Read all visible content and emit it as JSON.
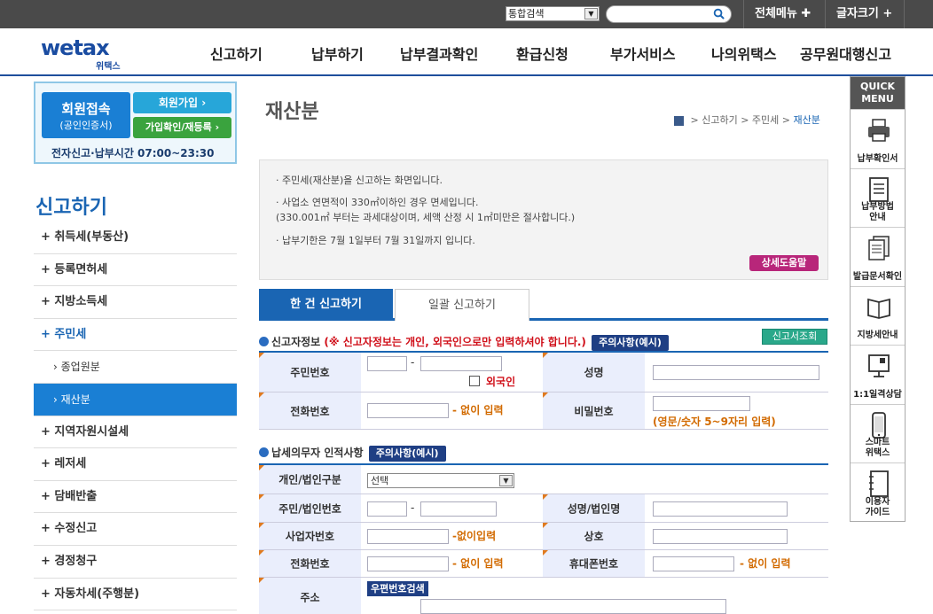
{
  "topbar": {
    "search_select": "통합검색",
    "menu_all": "전체메뉴",
    "font_size": "글자크기"
  },
  "logo": {
    "en": "wetax",
    "kr": "위택스"
  },
  "gnb": [
    "신고하기",
    "납부하기",
    "납부결과확인",
    "환급신청",
    "부가서비스",
    "나의위택스",
    "공무원대행신고"
  ],
  "login_box": {
    "member_login_1": "회원접속",
    "member_login_2": "(공인인증서)",
    "join": "회원가입",
    "rejoin": "가입확인/재등록",
    "hours": "전자신고·납부시간 07:00~23:30"
  },
  "lnb": {
    "title": "신고하기",
    "items": [
      {
        "label": "+ 취득세(부동산)",
        "kind": "item"
      },
      {
        "label": "+ 등록면허세",
        "kind": "item"
      },
      {
        "label": "+ 지방소득세",
        "kind": "item"
      },
      {
        "label": "+ 주민세",
        "kind": "active-parent"
      },
      {
        "label": "› 종업원분",
        "kind": "sub"
      },
      {
        "label": "› 재산분",
        "kind": "selected"
      },
      {
        "label": "+ 지역자원시설세",
        "kind": "item"
      },
      {
        "label": "+ 레저세",
        "kind": "item"
      },
      {
        "label": "+ 담배반출",
        "kind": "item"
      },
      {
        "label": "+ 수정신고",
        "kind": "item"
      },
      {
        "label": "+ 경정청구",
        "kind": "item"
      },
      {
        "label": "+ 자동차세(주행분)",
        "kind": "item"
      }
    ]
  },
  "quick": {
    "head_1": "QUICK",
    "head_2": "MENU",
    "items": [
      {
        "label_1": "납부확인서",
        "label_2": "",
        "icon": "printer-icon"
      },
      {
        "label_1": "납부방법",
        "label_2": "안내",
        "icon": "document-list-icon"
      },
      {
        "label_1": "발급문서확인",
        "label_2": "",
        "icon": "stacked-documents-icon"
      },
      {
        "label_1": "지방세안내",
        "label_2": "",
        "icon": "open-book-icon"
      },
      {
        "label_1": "1:1일격상담",
        "label_2": "",
        "icon": "chat-monitor-icon"
      },
      {
        "label_1": "스마트",
        "label_2": "위택스",
        "icon": "smartphone-icon"
      },
      {
        "label_1": "이용자",
        "label_2": "가이드",
        "icon": "notebook-icon"
      }
    ]
  },
  "page": {
    "title": "재산분",
    "breadcrumb": [
      "신고하기",
      "주민세",
      "재산분"
    ]
  },
  "info": {
    "line1": "· 주민세(재산분)을 신고하는 화면입니다.",
    "line2": "· 사업소 연면적이 330㎡이하인 경우 면세입니다.",
    "line3": "  (330.001㎡ 부터는 과세대상이며, 세액 산정 시 1㎡미만은 절사합니다.)",
    "line4": "· 납부기한은 7월 1일부터 7월 31일까지 입니다.",
    "help_button": "상세도움말"
  },
  "tabs": {
    "single": "한 건 신고하기",
    "bulk": "일괄 신고하기"
  },
  "reporter": {
    "section_title": "신고자정보",
    "warning": "(※ 신고자정보는 개인, 외국인으로만 입력하셔야 합니다.)",
    "notice_button": "주의사항(예시)",
    "lookup_button": "신고서조회",
    "rrn_label": "주민번호",
    "foreigner_label": "외국인",
    "name_label": "성명",
    "phone_label": "전화번호",
    "phone_note": "- 없이 입력",
    "password_label": "비밀번호",
    "password_note": "(영문/숫자 5~9자리 입력)"
  },
  "taxpayer": {
    "section_title": "납세의무자 인적사항",
    "notice_button": "주의사항(예시)",
    "type_label": "개인/법인구분",
    "type_value": "선택",
    "id_label": "주민/법인번호",
    "name_label": "성명/법인명",
    "bizno_label": "사업자번호",
    "bizno_note": "-없이입력",
    "company_label": "상호",
    "phone_label": "전화번호",
    "phone_note": "- 없이 입력",
    "mobile_label": "휴대폰번호",
    "mobile_note": "- 없이 입력",
    "address_label": "주소",
    "zip_button": "우편번호검색"
  }
}
